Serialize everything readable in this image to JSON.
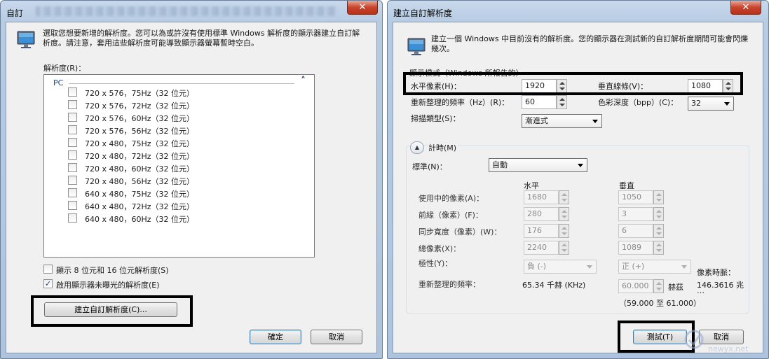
{
  "left": {
    "title": "自訂",
    "close_glyph": "✕",
    "description": "選取您想要新增的解析度。您可以為或許沒有使用標準 Windows 解析度的顯示器建立自訂解析度。請注意，套用這些解析度可能導致顯示器螢幕暫時空白。",
    "list_label": "解析度(R)：",
    "group_header": "PC",
    "collapse_glyph": "˄",
    "resolutions": [
      "720 x 576，75Hz（32 位元）",
      "720 x 576，72Hz（32 位元）",
      "720 x 576，60Hz（32 位元）",
      "720 x 576，56Hz（32 位元）",
      "720 x 480，75Hz（32 位元）",
      "720 x 480，72Hz（32 位元）",
      "720 x 480，60Hz（32 位元）",
      "720 x 480，56Hz（32 位元）",
      "640 x 480，75Hz（32 位元）",
      "640 x 480，72Hz（32 位元）",
      "640 x 480，60Hz（32 位元）"
    ],
    "opt_show_8_16": "顯示 8 位元和 16 位元解析度(S)",
    "opt_show_8_16_checked": false,
    "opt_unexposed": "啟用顯示器未曝光的解析度(E)",
    "opt_unexposed_checked": true,
    "check_glyph": "✓",
    "create_button": "建立自訂解析度(C)...",
    "ok_button": "確定",
    "cancel_button": "取消"
  },
  "right": {
    "title": "建立自訂解析度",
    "close_glyph": "✕",
    "description": "建立一個 Windows 中目前沒有的解析度。您的顯示器在測試新的自訂解析度期間可能會閃爍幾次。",
    "display_mode_label": "顯示模式（Windows 所報告的）",
    "h_pixels_label": "水平像素(H)：",
    "h_pixels_value": "1920",
    "v_lines_label": "垂直線條(V)：",
    "v_lines_value": "1080",
    "refresh_label": "重新整理的頻率（Hz）(R)：",
    "refresh_value": "60",
    "color_depth_label": "色彩深度（bpp）(C)：",
    "color_depth_value": "32",
    "scan_type_label": "掃描類型(S)：",
    "scan_type_value": "漸進式",
    "timing_toggle_glyph": "▲",
    "timing_label": "計時(M)",
    "standard_label": "標準(N)：",
    "standard_value": "自動",
    "col_horizontal": "水平",
    "col_vertical": "垂直",
    "timing_rows": [
      {
        "label": "使用中的像素(A)：",
        "h": "1680",
        "v": "1050"
      },
      {
        "label": "前緣（像素）(F)：",
        "h": "280",
        "v": "3"
      },
      {
        "label": "同步寬度（像素）(W)：",
        "h": "176",
        "v": "6"
      },
      {
        "label": "總像素(X)：",
        "h": "2240",
        "v": "1089"
      }
    ],
    "polarity_label": "極性(Y)：",
    "polarity_h": "負 (-)",
    "polarity_v": "正 (+)",
    "pixel_clock_label": "像素時脈：",
    "pixel_clock_value": "146.3616 兆",
    "pixel_clock_more": "…",
    "refresh_rate_label": "重新整理的頻率：",
    "refresh_rate_h": "65.34 千赫 (KHz)",
    "refresh_rate_v": "60.000",
    "refresh_rate_unit": "赫茲",
    "refresh_range": "（59.000 至 61.000）",
    "test_button": "測試(T)",
    "cancel_button": "取消"
  },
  "watermark": "newyx.net"
}
